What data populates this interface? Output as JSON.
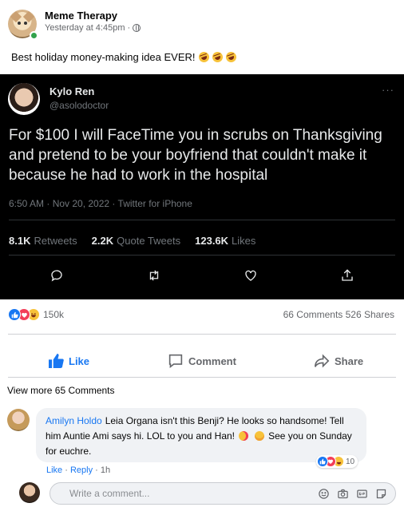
{
  "post": {
    "page_name": "Meme Therapy",
    "timestamp": "Yesterday at 4:45pm",
    "separator": "·",
    "caption": "Best holiday money-making idea EVER!"
  },
  "tweet": {
    "name": "Kylo Ren",
    "handle": "@asolodoctor",
    "more": "···",
    "text": "For $100 I will FaceTime you in scrubs on Thanksgiving and pretend to be your boyfriend that couldn't make it because he had to work in the hospital",
    "time": "6:50 AM · Nov 20, 2022 · Twitter for iPhone",
    "stats": [
      {
        "count": "8.1K",
        "label": "Retweets"
      },
      {
        "count": "2.2K",
        "label": "Quote Tweets"
      },
      {
        "count": "123.6K",
        "label": "Likes"
      }
    ]
  },
  "reactions": {
    "count": "150k",
    "comments_shares": "66 Comments 526 Shares"
  },
  "actions": {
    "like": "Like",
    "comment": "Comment",
    "share": "Share"
  },
  "view_more": "View more 65 Comments",
  "comment": {
    "author": "Amilyn Holdo",
    "text_part1": "Leia Organa isn't this Benji? He looks so handsome! Tell him Auntie Ami says hi. LOL to you and Han!",
    "text_part2": "See you on Sunday for euchre.",
    "react_count": "10",
    "like_link": "Like",
    "reply_link": "Reply",
    "age": "1h",
    "dot": "·"
  },
  "write_comment": {
    "placeholder": "Write a comment..."
  },
  "colors": {
    "facebook_blue": "#1877f2",
    "tweet_bg": "#000000",
    "muted": "#65676b"
  }
}
